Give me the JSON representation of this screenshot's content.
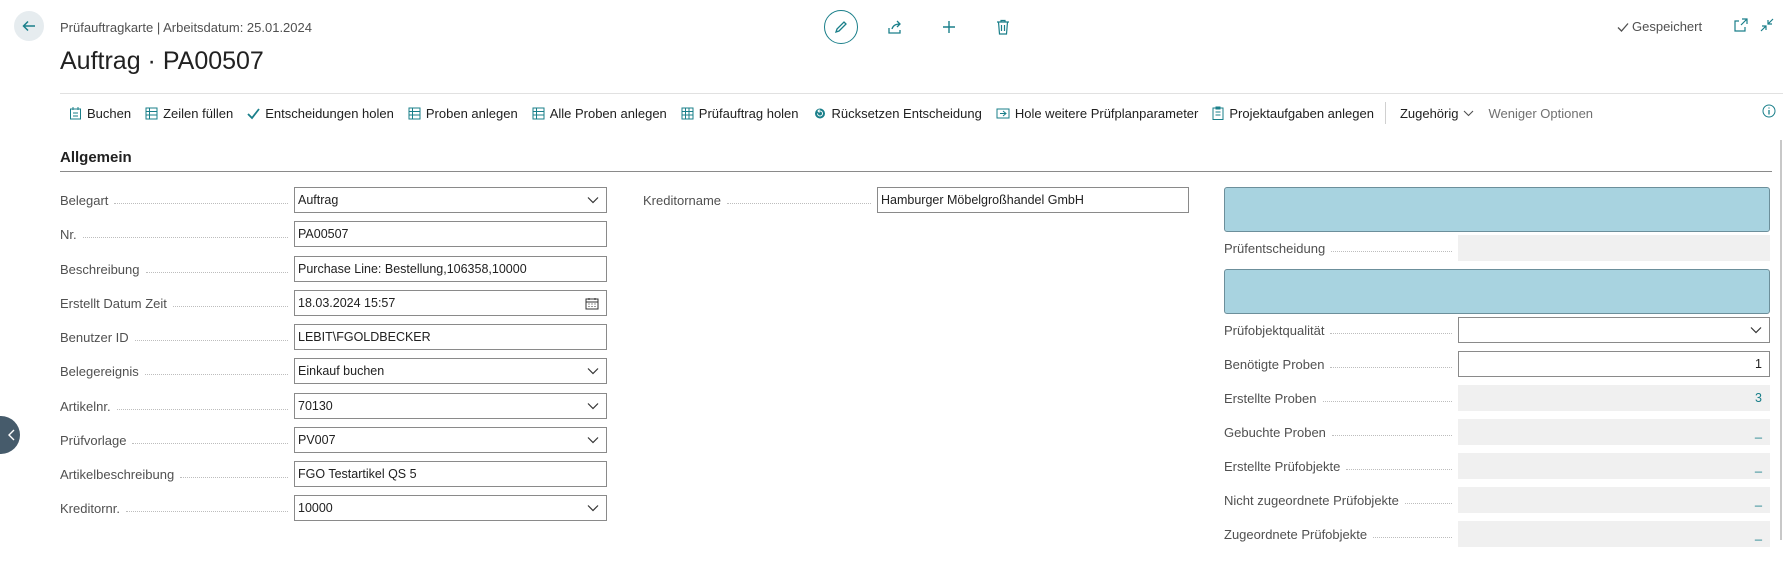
{
  "header": {
    "breadcrumb": "Prüfauftragkarte | Arbeitsdatum: 25.01.2024",
    "title": "Auftrag · PA00507",
    "saved_label": "Gespeichert"
  },
  "toolbar": {
    "items": [
      {
        "label": "Buchen",
        "icon": "post-icon"
      },
      {
        "label": "Zeilen füllen",
        "icon": "grid-icon"
      },
      {
        "label": "Entscheidungen holen",
        "icon": "check-icon"
      },
      {
        "label": "Proben anlegen",
        "icon": "grid-icon"
      },
      {
        "label": "Alle Proben anlegen",
        "icon": "grid-icon"
      },
      {
        "label": "Prüfauftrag holen",
        "icon": "table-icon"
      },
      {
        "label": "Rücksetzen Entscheidung",
        "icon": "reset-icon"
      },
      {
        "label": "Hole weitere Prüfplanparameter",
        "icon": "import-icon"
      },
      {
        "label": "Projektaufgaben anlegen",
        "icon": "clipboard-icon"
      }
    ],
    "related_label": "Zugehörig",
    "fewer_label": "Weniger Optionen"
  },
  "section": {
    "title": "Allgemein"
  },
  "fields_left": [
    {
      "label": "Belegart",
      "value": "Auftrag",
      "dropdown": true
    },
    {
      "label": "Nr.",
      "value": "PA00507"
    },
    {
      "label": "Beschreibung",
      "value": "Purchase Line: Bestellung,106358,10000"
    },
    {
      "label": "Erstellt Datum Zeit",
      "value": "18.03.2024 15:57",
      "calendar": true
    },
    {
      "label": "Benutzer ID",
      "value": "LEBIT\\FGOLDBECKER"
    },
    {
      "label": "Belegereignis",
      "value": "Einkauf buchen",
      "dropdown": true
    },
    {
      "label": "Artikelnr.",
      "value": "70130",
      "dropdown": true
    },
    {
      "label": "Prüfvorlage",
      "value": "PV007",
      "dropdown": true
    },
    {
      "label": "Artikelbeschreibung",
      "value": "FGO Testartikel QS 5"
    },
    {
      "label": "Kreditornr.",
      "value": "10000",
      "dropdown": true
    }
  ],
  "fields_middle": [
    {
      "label": "Kreditorname",
      "value": "Hamburger Möbelgroßhandel GmbH"
    }
  ],
  "fields_right": {
    "pruefentscheidung": {
      "label": "Prüfentscheidung",
      "value": ""
    },
    "pruefobjektqualitaet": {
      "label": "Prüfobjektqualität",
      "value": ""
    },
    "benoetigte_proben": {
      "label": "Benötigte Proben",
      "value": "1"
    },
    "erstellte_proben": {
      "label": "Erstellte Proben",
      "value": "3"
    },
    "gebuchte_proben": {
      "label": "Gebuchte Proben",
      "value": "_"
    },
    "erstellte_pruefobjekte": {
      "label": "Erstellte Prüfobjekte",
      "value": "_"
    },
    "nicht_zugeordnete": {
      "label": "Nicht zugeordnete Prüfobjekte",
      "value": "_"
    },
    "zugeordnete": {
      "label": "Zugeordnete Prüfobjekte",
      "value": "_"
    }
  },
  "colors": {
    "accent": "#1a7f8a",
    "status_box": "#a8d3e0"
  }
}
